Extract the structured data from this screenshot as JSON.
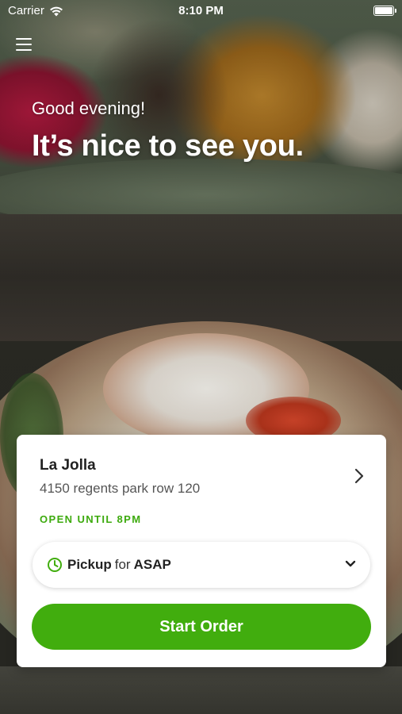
{
  "status_bar": {
    "carrier": "Carrier",
    "time": "8:10 PM"
  },
  "hero": {
    "greeting": "Good evening!",
    "tagline": "It’s nice to see you."
  },
  "location_card": {
    "name": "La Jolla",
    "address": "4150 regents park row 120",
    "hours": "OPEN UNTIL 8PM",
    "order_mode": "Pickup",
    "connector": "for",
    "timing": "ASAP",
    "start_button_label": "Start Order"
  },
  "colors": {
    "accent_green": "#41ad0e",
    "hours_green": "#3daa0e"
  },
  "icons": [
    "menu-icon",
    "wifi-icon",
    "battery-icon",
    "chevron-right-icon",
    "clock-icon",
    "chevron-down-icon"
  ]
}
